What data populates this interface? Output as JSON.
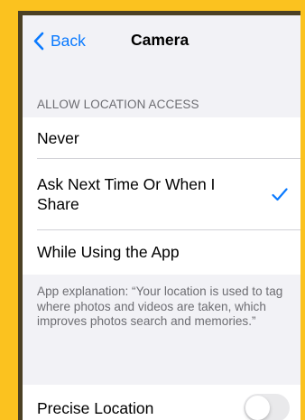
{
  "colors": {
    "frame": "#FBC21F",
    "frame_border": "#4B4024",
    "background": "#F2F2F6",
    "accent": "#0A7AFF",
    "secondary_text": "#6D6D72",
    "toggle_off": "#E9E9EB"
  },
  "nav": {
    "back_icon": "chevron-left-icon",
    "back_label": "Back",
    "title": "Camera"
  },
  "location_access": {
    "header": "ALLOW LOCATION ACCESS",
    "options": [
      {
        "label": "Never",
        "selected": false
      },
      {
        "label": "Ask Next Time Or When I Share",
        "selected": true
      },
      {
        "label": "While Using the App",
        "selected": false
      }
    ],
    "selected_icon": "checkmark-icon",
    "footer": "App explanation: “Your location is used to tag where photos and videos are taken, which improves photos search and memories.”"
  },
  "precise_location": {
    "label": "Precise Location",
    "enabled": false
  }
}
